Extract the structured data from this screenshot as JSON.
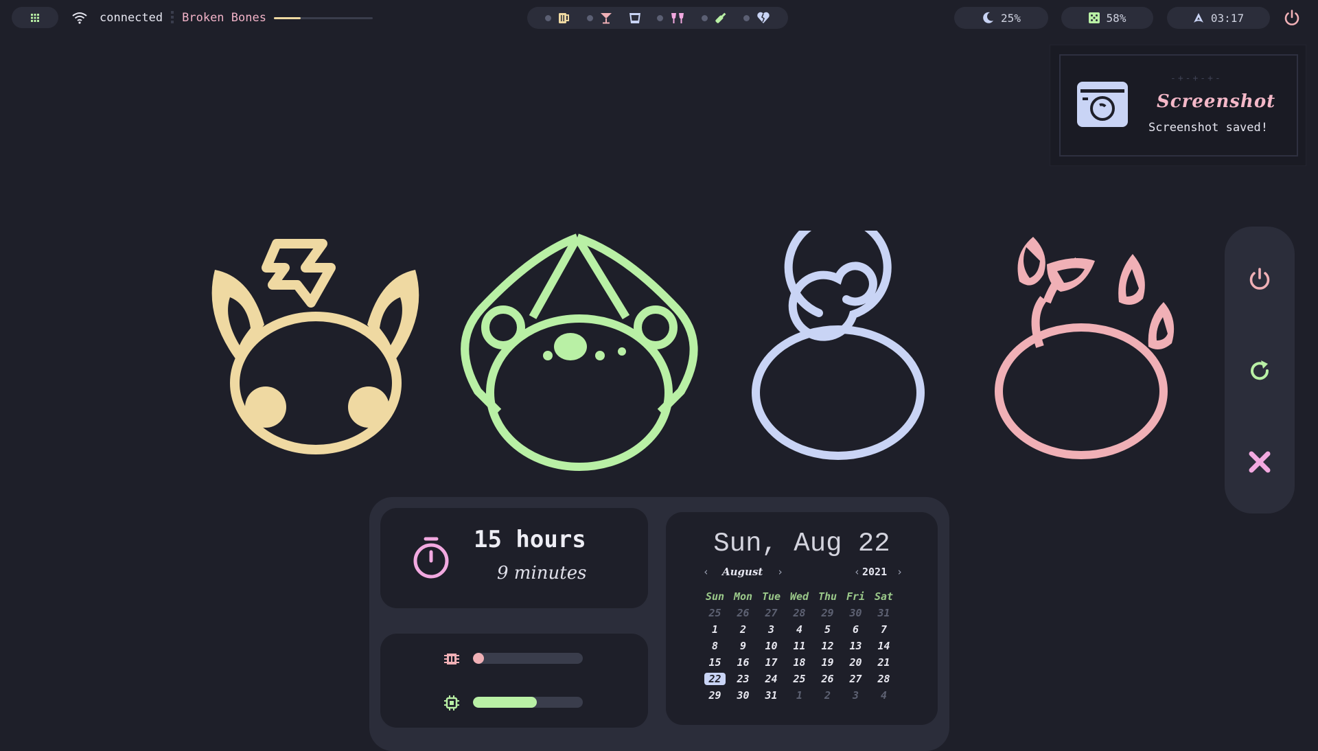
{
  "topbar": {
    "network_status": "connected",
    "now_playing": "Broken Bones",
    "song_progress": 0.27,
    "stats": {
      "night_light": "25%",
      "disk": "58%",
      "time": "03:17"
    },
    "workspaces": [
      {
        "icon": "beer-mug-icon"
      },
      {
        "icon": "cocktail-glass-icon"
      },
      {
        "icon": "tumbler-glass-icon"
      },
      {
        "icon": "clinking-glasses-icon"
      },
      {
        "icon": "wine-bottle-icon"
      },
      {
        "icon": "broken-heart-icon"
      }
    ]
  },
  "notification": {
    "title": "Screenshot",
    "body": "Screenshot saved!",
    "decoration": "-+-+-+-"
  },
  "timer": {
    "hours": "15 hours",
    "minutes": "9 minutes"
  },
  "system": {
    "ram_usage": 0.04,
    "cpu_usage": 0.58
  },
  "calendar": {
    "date_label": "Sun, Aug 22",
    "month": "August",
    "year": "2021",
    "weekdays": [
      "Sun",
      "Mon",
      "Tue",
      "Wed",
      "Thu",
      "Fri",
      "Sat"
    ],
    "weeks": [
      [
        "25",
        "26",
        "27",
        "28",
        "29",
        "30",
        "31"
      ],
      [
        "1",
        "2",
        "3",
        "4",
        "5",
        "6",
        "7"
      ],
      [
        "8",
        "9",
        "10",
        "11",
        "12",
        "13",
        "14"
      ],
      [
        "15",
        "16",
        "17",
        "18",
        "19",
        "20",
        "21"
      ],
      [
        "22",
        "23",
        "24",
        "25",
        "26",
        "27",
        "28"
      ],
      [
        "29",
        "30",
        "31",
        "1",
        "2",
        "3",
        "4"
      ]
    ],
    "today": "22"
  },
  "colors": {
    "background": "#1e1f29",
    "panel": "#2b2d3a",
    "yellow": "#efd9a2",
    "green": "#b9f0a5",
    "blue": "#c9d4f5",
    "pink": "#f0b0b6",
    "magenta": "#f2a9e0"
  }
}
